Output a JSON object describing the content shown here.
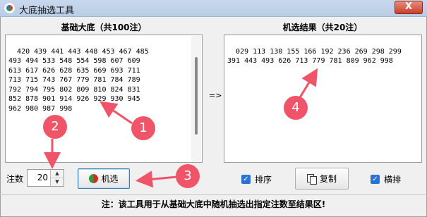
{
  "window": {
    "title": "大底抽选工具",
    "close_glyph": "X"
  },
  "left_panel": {
    "title": "基础大底（共100注）",
    "content": "420 439 441 443 448 453 467 485\n493 494 533 548 554 598 607 609\n613 617 626 628 635 669 693 711\n713 715 743 767 779 781 784 789\n792 794 795 802 809 810 824 831\n852 878 901 914 926 929 930 945\n962 980 987 998"
  },
  "right_panel": {
    "title": "机选结果（共20注）",
    "content": "029 113 130 155 166 192 236 269 298 299\n391 443 493 626 713 779 781 809 962 998"
  },
  "transfer_arrow": "=>",
  "controls": {
    "count_label": "注数",
    "count_value": "20",
    "spin_up": "▲",
    "spin_down": "▼",
    "select_button": "机选",
    "sort_label": "排序",
    "sort_checked": true,
    "copy_button": "复制",
    "horizontal_label": "横排",
    "horizontal_checked": true
  },
  "status_text": "注：该工具用于从基础大底中随机抽选出指定注数至结果区!",
  "annotations": {
    "markers": [
      "1",
      "2",
      "3",
      "4"
    ],
    "color": "#f05468"
  }
}
